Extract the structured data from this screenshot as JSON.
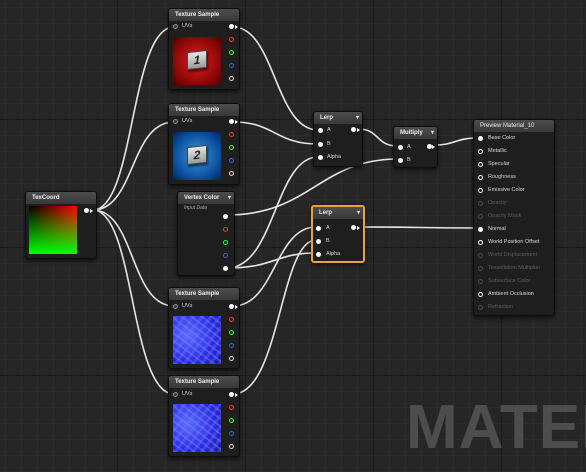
{
  "nodes": {
    "tex_sample_1": {
      "title": "Texture Sample",
      "uvs": "UVs",
      "badge": "1"
    },
    "tex_sample_2": {
      "title": "Texture Sample",
      "uvs": "UVs",
      "badge": "2"
    },
    "tex_sample_3": {
      "title": "Texture Sample",
      "uvs": "UVs"
    },
    "tex_sample_4": {
      "title": "Texture Sample",
      "uvs": "UVs"
    },
    "texcoord": {
      "title": "TexCoord"
    },
    "vertex_color": {
      "title": "Vertex Color",
      "subtitle": "Input Data"
    },
    "lerp_1": {
      "title": "Lerp",
      "a": "A",
      "b": "B",
      "alpha": "Alpha"
    },
    "lerp_2": {
      "title": "Lerp",
      "a": "A",
      "b": "B",
      "alpha": "Alpha"
    },
    "multiply": {
      "title": "Multiply",
      "a": "A",
      "b": "B"
    },
    "material": {
      "title": "Preview Material_10",
      "inputs": [
        {
          "label": "Base Color",
          "active": true
        },
        {
          "label": "Metallic",
          "active": true
        },
        {
          "label": "Specular",
          "active": true
        },
        {
          "label": "Roughness",
          "active": true
        },
        {
          "label": "Emissive Color",
          "active": true
        },
        {
          "label": "Opacity",
          "active": false
        },
        {
          "label": "Opacity Mask",
          "active": false
        },
        {
          "label": "Normal",
          "active": true
        },
        {
          "label": "World Position Offset",
          "active": true
        },
        {
          "label": "World Displacement",
          "active": false
        },
        {
          "label": "Tessellation Multiplier",
          "active": false
        },
        {
          "label": "Subsurface Color",
          "active": false
        },
        {
          "label": "Ambient Occlusion",
          "active": true
        },
        {
          "label": "Refraction",
          "active": false
        }
      ]
    }
  },
  "watermark": "MATER",
  "colors": {
    "selection": "#e8a33c",
    "wire": "#ffffff",
    "pin_red": "#ff3030",
    "pin_green": "#30ff30",
    "pin_blue": "#3a5aff"
  }
}
